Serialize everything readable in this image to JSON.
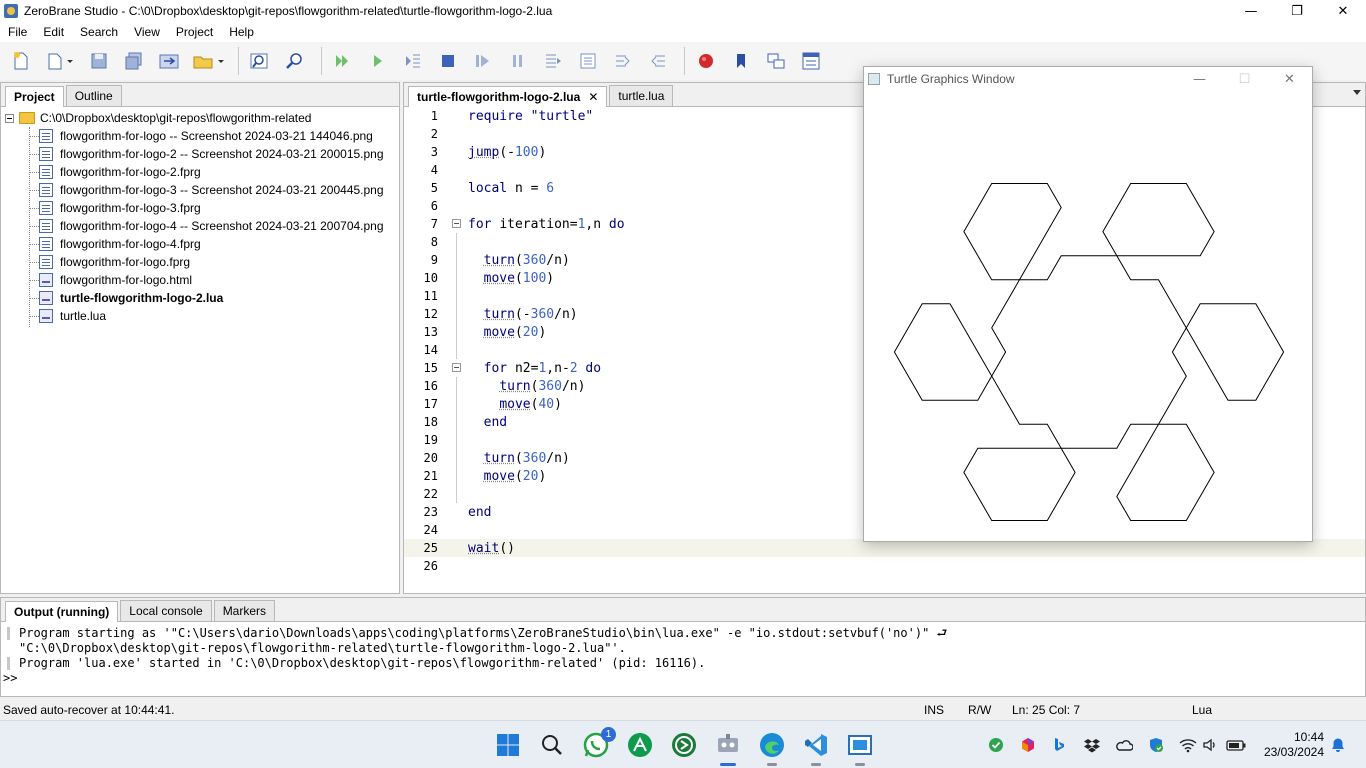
{
  "window": {
    "title": "ZeroBrane Studio - C:\\0\\Dropbox\\desktop\\git-repos\\flowgorithm-related\\turtle-flowgorithm-logo-2.lua",
    "min": "—",
    "max": "❐",
    "close": "✕"
  },
  "menu": [
    "File",
    "Edit",
    "Search",
    "View",
    "Project",
    "Help"
  ],
  "toolbar": [
    "new-file-icon",
    "open-file-icon",
    "save-icon",
    "save-all-icon",
    "project-folder-icon",
    "project-folder-down-icon",
    "find-icon",
    "find-in-files-icon",
    "run-icon",
    "start-debug-icon",
    "step-over-icon",
    "stop-icon",
    "step-icon",
    "break-icon",
    "step-into-icon",
    "step-out-icon",
    "run-to-cursor-icon",
    "toggle-breakpoint-icon",
    "bookmark-icon",
    "watch-icon",
    "stack-icon"
  ],
  "project_panel": {
    "tabs": [
      "Project",
      "Outline"
    ],
    "root": "C:\\0\\Dropbox\\desktop\\git-repos\\flowgorithm-related",
    "files": [
      {
        "name": "flowgorithm-for-logo -- Screenshot 2024-03-21 144046.png",
        "type": "png"
      },
      {
        "name": "flowgorithm-for-logo-2 -- Screenshot 2024-03-21 200015.png",
        "type": "png"
      },
      {
        "name": "flowgorithm-for-logo-2.fprg",
        "type": "fprg"
      },
      {
        "name": "flowgorithm-for-logo-3 -- Screenshot 2024-03-21 200445.png",
        "type": "png"
      },
      {
        "name": "flowgorithm-for-logo-3.fprg",
        "type": "fprg"
      },
      {
        "name": "flowgorithm-for-logo-4 -- Screenshot 2024-03-21 200704.png",
        "type": "png"
      },
      {
        "name": "flowgorithm-for-logo-4.fprg",
        "type": "fprg"
      },
      {
        "name": "flowgorithm-for-logo.fprg",
        "type": "fprg"
      },
      {
        "name": "flowgorithm-for-logo.html",
        "type": "html"
      },
      {
        "name": "turtle-flowgorithm-logo-2.lua",
        "type": "lua",
        "bold": true
      },
      {
        "name": "turtle.lua",
        "type": "lua"
      }
    ]
  },
  "editor": {
    "tabs": [
      {
        "label": "turtle-flowgorithm-logo-2.lua",
        "close": "✕"
      },
      {
        "label": "turtle.lua"
      }
    ],
    "lines": [
      "require \"turtle\"",
      "",
      "jump(-100)",
      "",
      "local n = 6",
      "",
      "for iteration=1,n do",
      "",
      "  turn(360/n)",
      "  move(100)",
      "",
      "  turn(-360/n)",
      "  move(20)",
      "",
      "  for n2=1,n-2 do",
      "    turn(360/n)",
      "    move(40)",
      "  end",
      "",
      "  turn(360/n)",
      "  move(20)",
      "",
      "end",
      "",
      "wait()",
      ""
    ]
  },
  "turtle_window": {
    "title": "Turtle Graphics Window",
    "min": "—",
    "max": "☐",
    "close": "✕"
  },
  "output": {
    "tabs": [
      "Output (running)",
      "Local console",
      "Markers"
    ],
    "lines": [
      "Program starting as '\"C:\\Users\\dario\\Downloads\\apps\\coding\\platforms\\ZeroBraneStudio\\bin\\lua.exe\" -e \"io.stdout:setvbuf('no')\" ⮐",
      "\"C:\\0\\Dropbox\\desktop\\git-repos\\flowgorithm-related\\turtle-flowgorithm-logo-2.lua\"'.",
      "Program 'lua.exe' started in 'C:\\0\\Dropbox\\desktop\\git-repos\\flowgorithm-related' (pid: 16116)."
    ],
    "prompt": ">>"
  },
  "status": {
    "message": "Saved auto-recover at 10:44:41.",
    "ins": "INS",
    "rw": "R/W",
    "position": "Ln: 25 Col: 7",
    "language": "Lua"
  },
  "taskbar": {
    "apps": [
      "windows-start-icon",
      "search-icon",
      "whatsapp-icon",
      "green-app-icon",
      "terminal-app-icon",
      "zerobrane-icon",
      "edge-icon",
      "vscode-icon",
      "window-app-icon"
    ],
    "whatsapp_badge": "1",
    "tray": [
      "check-icon",
      "colorful-app-icon",
      "bing-icon",
      "dropbox-icon",
      "onedrive-icon",
      "security-icon",
      "wifi-icon",
      "volume-icon",
      "battery-icon",
      "notification-bell-icon"
    ],
    "time": "10:44",
    "date": "23/03/2024"
  }
}
